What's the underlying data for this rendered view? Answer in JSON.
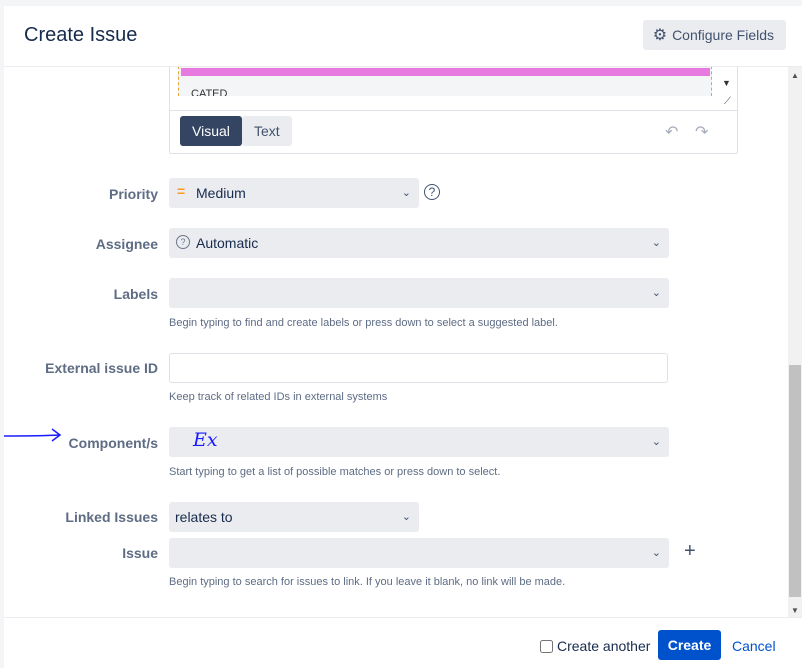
{
  "dialog": {
    "title": "Create Issue",
    "configure_label": "Configure Fields"
  },
  "editor": {
    "tab_visual": "Visual",
    "tab_text": "Text",
    "cut_text": "CATED"
  },
  "fields": {
    "priority": {
      "label": "Priority",
      "value": "Medium",
      "icon": "priority-medium-icon",
      "color": "#ff991f"
    },
    "assignee": {
      "label": "Assignee",
      "value": "Automatic"
    },
    "labels": {
      "label": "Labels",
      "value": "",
      "hint": "Begin typing to find and create labels or press down to select a suggested label."
    },
    "external_id": {
      "label": "External issue ID",
      "value": "",
      "hint": "Keep track of related IDs in external systems"
    },
    "components": {
      "label": "Component/s",
      "value": "",
      "hint": "Start typing to get a list of possible matches or press down to select.",
      "annotation": "Ex"
    },
    "linked_issues": {
      "label": "Linked Issues",
      "value": "relates to"
    },
    "issue": {
      "label": "Issue",
      "value": "",
      "hint": "Begin typing to search for issues to link. If you leave it blank, no link will be made."
    }
  },
  "footer": {
    "create_another": "Create another",
    "create": "Create",
    "cancel": "Cancel"
  },
  "colors": {
    "primary": "#0052cc",
    "annotation_ink": "#1a1aff"
  }
}
